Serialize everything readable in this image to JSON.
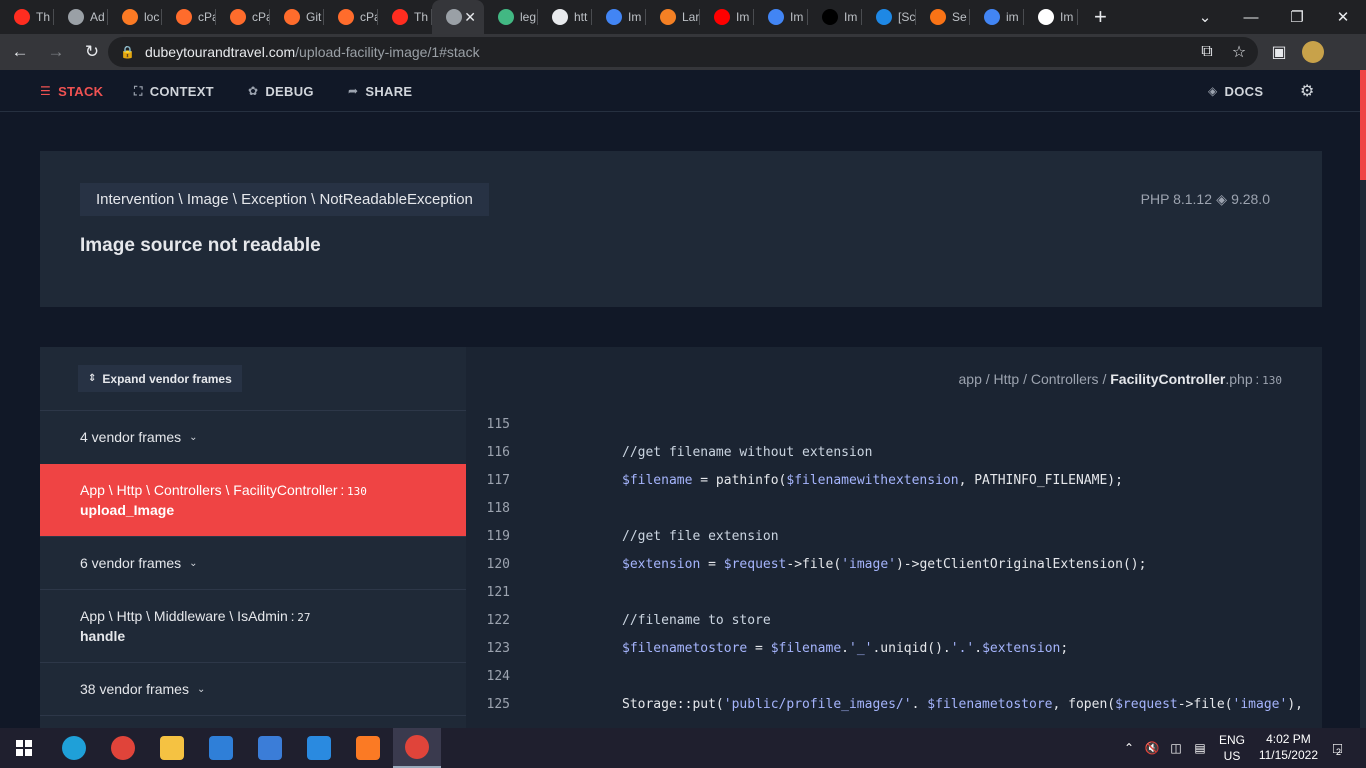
{
  "browser": {
    "tabs": [
      {
        "label": "Th",
        "icon": "laravel-icon",
        "color": "#ff2d20"
      },
      {
        "label": "Ad",
        "icon": "globe-icon",
        "color": "#9aa0a6"
      },
      {
        "label": "loc",
        "icon": "xampp-icon",
        "color": "#fb7a24"
      },
      {
        "label": "cPa",
        "icon": "cpanel-icon",
        "color": "#ff6c2c"
      },
      {
        "label": "cPa",
        "icon": "cpanel-icon",
        "color": "#ff6c2c"
      },
      {
        "label": "Git",
        "icon": "cpanel-icon",
        "color": "#ff6c2c"
      },
      {
        "label": "cPa",
        "icon": "cpanel-icon",
        "color": "#ff6c2c"
      },
      {
        "label": "Th",
        "icon": "laravel-icon",
        "color": "#ff2d20"
      },
      {
        "label": "",
        "icon": "globe-icon",
        "color": "#9aa0a6",
        "active": true
      },
      {
        "label": "leg",
        "icon": "vue-icon",
        "color": "#42b883"
      },
      {
        "label": "htt",
        "icon": "bulb-icon",
        "color": "#e8eaed"
      },
      {
        "label": "Im",
        "icon": "google-icon",
        "color": "#4285f4"
      },
      {
        "label": "Lar",
        "icon": "stackoverflow-icon",
        "color": "#f48024"
      },
      {
        "label": "Im",
        "icon": "youtube-icon",
        "color": "#ff0000"
      },
      {
        "label": "Im",
        "icon": "google-icon",
        "color": "#4285f4"
      },
      {
        "label": "Im",
        "icon": "dev-icon",
        "color": "#000000"
      },
      {
        "label": "[Sc",
        "icon": "framer-icon",
        "color": "#1e88e5"
      },
      {
        "label": "Se",
        "icon": "spark-icon",
        "color": "#f97316"
      },
      {
        "label": "im",
        "icon": "google-icon",
        "color": "#4285f4"
      },
      {
        "label": "Im",
        "icon": "github-icon",
        "color": "#ffffff"
      }
    ],
    "url_host": "dubeytourandtravel.com",
    "url_path": "/upload-facility-image/1#stack"
  },
  "ignition": {
    "nav": {
      "stack": "STACK",
      "context": "CONTEXT",
      "debug": "DEBUG",
      "share": "SHARE",
      "docs": "DOCS"
    },
    "exception_class": "Intervention \\ Image \\ Exception \\ NotReadableException",
    "message": "Image source not readable",
    "php_version": "PHP 8.1.12",
    "laravel_version": "9.28.0",
    "expand_label": "Expand vendor frames",
    "frames": [
      {
        "type": "vendor",
        "label": "4 vendor frames"
      },
      {
        "type": "app",
        "class": "App \\ Http \\ Controllers \\ FacilityController",
        "line": "130",
        "method": "upload_Image",
        "selected": true
      },
      {
        "type": "vendor",
        "label": "6 vendor frames"
      },
      {
        "type": "app",
        "class": "App \\ Http \\ Middleware \\ IsAdmin",
        "line": "27",
        "method": "handle"
      },
      {
        "type": "vendor",
        "label": "38 vendor frames"
      }
    ],
    "file_path_prefix": "app / Http / Controllers / ",
    "file_name": "FacilityController",
    "file_ext": ".php",
    "file_line": "130",
    "code_lines": [
      {
        "num": "115",
        "code": ""
      },
      {
        "num": "116",
        "code": "//get filename without extension"
      },
      {
        "num": "117",
        "code": "$filename = pathinfo($filenamewithextension, PATHINFO_FILENAME);"
      },
      {
        "num": "118",
        "code": ""
      },
      {
        "num": "119",
        "code": "//get file extension"
      },
      {
        "num": "120",
        "code": "$extension = $request->file('image')->getClientOriginalExtension();"
      },
      {
        "num": "121",
        "code": ""
      },
      {
        "num": "122",
        "code": "//filename to store"
      },
      {
        "num": "123",
        "code": "$filenametostore = $filename.'_'.uniqid().'.'.$extension;"
      },
      {
        "num": "124",
        "code": ""
      },
      {
        "num": "125",
        "code": "Storage::put('public/profile_images/'. $filenametostore, fopen($request->file('image'),"
      }
    ]
  },
  "taskbar": {
    "apps": [
      "windows-start-icon",
      "edge-icon",
      "chrome-icon",
      "file-explorer-icon",
      "mail-icon",
      "store-icon",
      "vscode-icon",
      "xampp-icon",
      "chrome-profile-icon"
    ],
    "lang_line1": "ENG",
    "lang_line2": "US",
    "time": "4:02 PM",
    "date": "11/15/2022",
    "notification_count": "2"
  },
  "colors": {
    "accent": "#ef4444",
    "panel": "#1f2937",
    "background": "#111827"
  }
}
